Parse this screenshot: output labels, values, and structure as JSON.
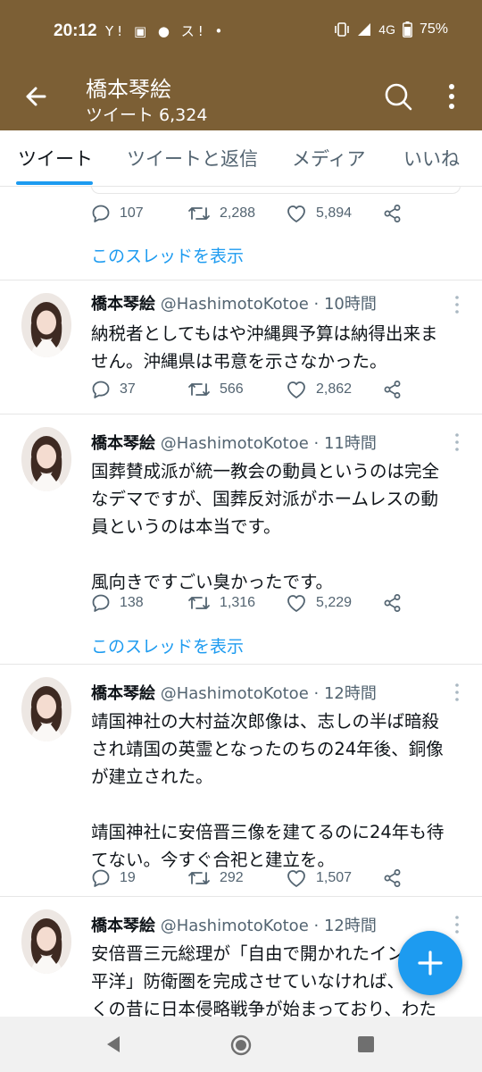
{
  "status_bar": {
    "time": "20:12",
    "left_icons": "Y! ▣ ● ス! •",
    "network": "4G",
    "battery": "75%"
  },
  "header": {
    "title": "橋本琴絵",
    "subtitle": "ツイート 6,324"
  },
  "tabs": [
    "ツイート",
    "ツイートと返信",
    "メディア",
    "いいね"
  ],
  "top_item": {
    "replies": "107",
    "retweets": "2,288",
    "likes": "5,894",
    "thread_link": "このスレッドを表示"
  },
  "tweets": [
    {
      "name": "橋本琴絵",
      "handle": "@HashimotoKotoe",
      "time": "· 10時間",
      "text": "納税者としてもはや沖縄興予算は納得出来ま\nせん。沖縄県は弔意を示さなかった。",
      "replies": "37",
      "retweets": "566",
      "likes": "2,862"
    },
    {
      "name": "橋本琴絵",
      "handle": "@HashimotoKotoe",
      "time": "· 11時間",
      "text": "国葬賛成派が統一教会の動員というのは完全\nなデマですが、国葬反対派がホームレスの動\n員というのは本当です。\n\n風向きですごい臭かったです。",
      "replies": "138",
      "retweets": "1,316",
      "likes": "5,229",
      "thread_link": "このスレッドを表示"
    },
    {
      "name": "橋本琴絵",
      "handle": "@HashimotoKotoe",
      "time": "· 12時間",
      "text": "靖国神社の大村益次郎像は、志しの半ば暗殺\nされ靖国の英霊となったのちの24年後、銅像\nが建立された。\n\n靖国神社に安倍晋三像を建てるのに24年も待\nてない。今すぐ合祀と建立を。",
      "replies": "19",
      "retweets": "292",
      "likes": "1,507"
    },
    {
      "name": "橋本琴絵",
      "handle": "@HashimotoKotoe",
      "time": "· 12時間",
      "text": "安倍晋三元総理が「自由で開かれたインド太\n平洋」防衛圏を完成させていなければ、とっ\nくの昔に日本侵略戦争が始まっており、わた\nしたちはもうこんな日常を過ごせていなかった"
    }
  ],
  "colors": {
    "header_bg": "#7c5f35",
    "accent": "#1d9bf0"
  }
}
